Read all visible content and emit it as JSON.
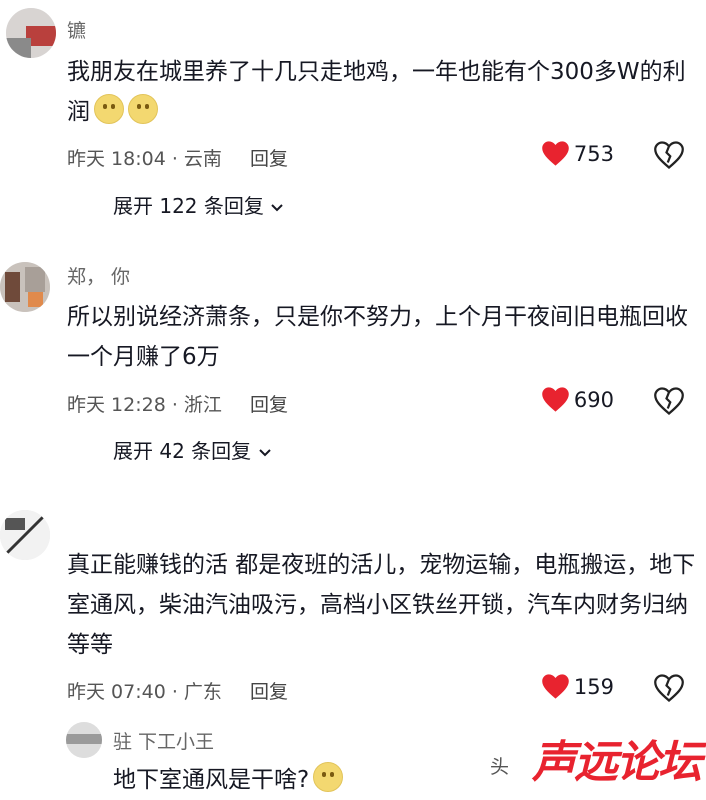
{
  "comments": [
    {
      "username": "镳",
      "text": "我朋友在城里养了十几只走地鸡，一年也能有个300多W的利润",
      "time": "昨天 18:04",
      "location": "云南",
      "reply_label": "回复",
      "likes": "753",
      "expand_label": "展开 122 条回复"
    },
    {
      "username": "郑，  你",
      "text": "所以别说经济萧条，只是你不努力，上个月干夜间旧电瓶回收一个月赚了6万",
      "time": "昨天 12:28",
      "location": "浙江",
      "reply_label": "回复",
      "likes": "690",
      "expand_label": "展开 42 条回复"
    },
    {
      "username": "",
      "text": "真正能赚钱的活 都是夜班的活儿，宠物运输，电瓶搬运，地下室通风，柴油汽油吸污，高档小区铁丝开锁，汽车内财务归纳等等",
      "time": "昨天 07:40",
      "location": "广东",
      "reply_label": "回复",
      "likes": "159"
    }
  ],
  "sub_reply": {
    "username": "驻  下工小王",
    "text": "地下室通风是干啥?"
  },
  "side_fragment": "头",
  "watermark": "声远论坛",
  "colors": {
    "heart": "#e8232f",
    "watermark": "#e8232f",
    "meta": "#555555"
  }
}
